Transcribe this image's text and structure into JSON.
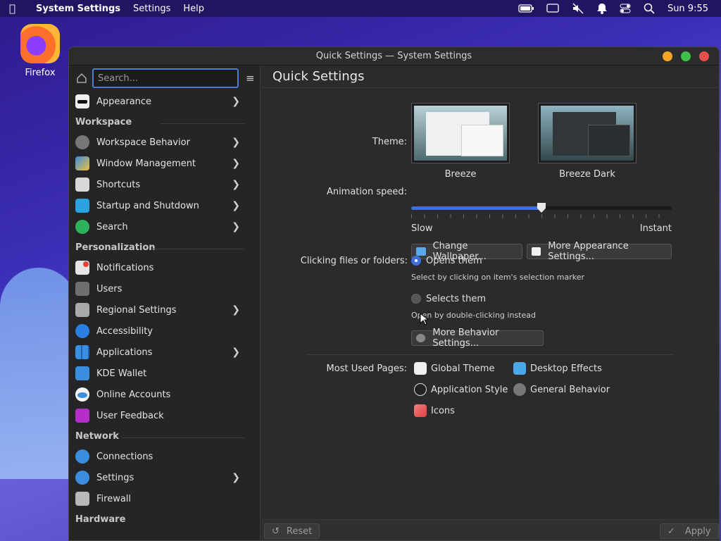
{
  "menubar": {
    "app_name": "System Settings",
    "menus": [
      "Settings",
      "Help"
    ],
    "clock": "Sun 9:55"
  },
  "desktop": {
    "icons": [
      {
        "label": "Firefox"
      }
    ]
  },
  "window": {
    "title": "Quick Settings — System Settings"
  },
  "sidebar": {
    "search_placeholder": "Search...",
    "top_items": [
      {
        "label": "Appearance",
        "icon": "appearance-icon"
      }
    ],
    "sections": [
      {
        "title": "Workspace",
        "items": [
          {
            "label": "Workspace Behavior"
          },
          {
            "label": "Window Management"
          },
          {
            "label": "Shortcuts"
          },
          {
            "label": "Startup and Shutdown"
          },
          {
            "label": "Search"
          }
        ]
      },
      {
        "title": "Personalization",
        "items": [
          {
            "label": "Notifications"
          },
          {
            "label": "Users"
          },
          {
            "label": "Regional Settings"
          },
          {
            "label": "Accessibility"
          },
          {
            "label": "Applications"
          },
          {
            "label": "KDE Wallet"
          },
          {
            "label": "Online Accounts"
          },
          {
            "label": "User Feedback"
          }
        ]
      },
      {
        "title": "Network",
        "items": [
          {
            "label": "Connections"
          },
          {
            "label": "Settings"
          },
          {
            "label": "Firewall"
          }
        ]
      },
      {
        "title": "Hardware",
        "items": []
      }
    ]
  },
  "content": {
    "title": "Quick Settings",
    "theme_label": "Theme:",
    "themes": [
      {
        "name": "Breeze"
      },
      {
        "name": "Breeze Dark"
      }
    ],
    "animation_label": "Animation speed:",
    "animation_value": 0.5,
    "slow_label": "Slow",
    "instant_label": "Instant",
    "change_wallpaper": "Change Wallpaper...",
    "more_appearance": "More Appearance Settings...",
    "clicking_label": "Clicking files or folders:",
    "opens_them": "Opens them",
    "opens_hint": "Select by clicking on item's selection marker",
    "selects_them": "Selects them",
    "selects_hint": "Open by double-clicking instead",
    "more_behavior": "More Behavior Settings...",
    "most_used_label": "Most Used Pages:",
    "most_used": [
      {
        "label": "Global Theme"
      },
      {
        "label": "Desktop Effects"
      },
      {
        "label": "Application Style"
      },
      {
        "label": "General Behavior"
      },
      {
        "label": "Icons"
      }
    ]
  },
  "footer": {
    "reset": "Reset",
    "apply": "Apply"
  },
  "colors": {
    "accent": "#3f6fd8",
    "close": "#e8504a",
    "minimize": "#f5a623",
    "maximize": "#3fbf4a"
  }
}
